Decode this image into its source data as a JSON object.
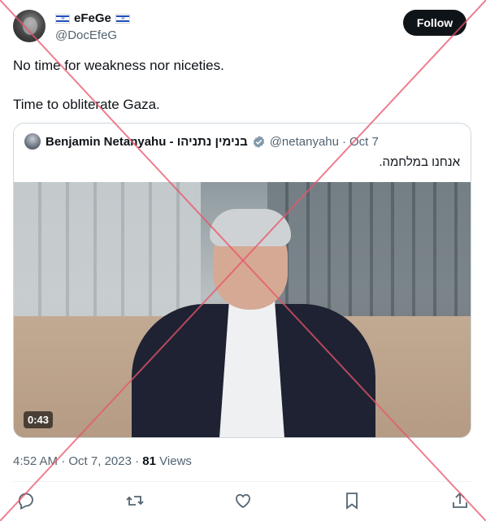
{
  "author": {
    "display_name": "eFeGe",
    "handle": "@DocEfeG",
    "flag_icon": "israel-flag-icon"
  },
  "follow_label": "Follow",
  "tweet": {
    "line1": "No time for weakness nor niceties.",
    "line2": "Time to obliterate Gaza."
  },
  "quote": {
    "name": "Benjamin Netanyahu - בנימין נתניהו",
    "handle": "@netanyahu",
    "separator": "·",
    "date": "Oct 7",
    "text": "אנחנו במלחמה.",
    "video_duration": "0:43"
  },
  "meta": {
    "time": "4:52 AM",
    "separator1": "·",
    "date": "Oct 7, 2023",
    "separator2": "·",
    "views_count": "81",
    "views_label": "Views"
  },
  "actions": {
    "icons": [
      "reply-icon",
      "retweet-icon",
      "like-icon",
      "bookmark-icon",
      "share-icon"
    ]
  },
  "colors": {
    "text": "#0f1419",
    "secondary": "#536471",
    "verified": "#829aab",
    "overlay_x": "#e8556a"
  }
}
